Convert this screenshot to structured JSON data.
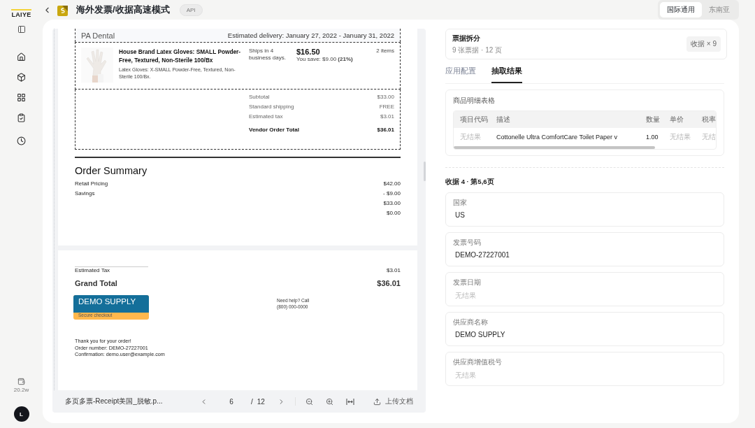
{
  "sidebar": {
    "logo": "LAIYE",
    "credits": "20.2w",
    "avatar": "L"
  },
  "header": {
    "title": "海外发票/收据高速模式",
    "badge": "API"
  },
  "region_tabs": [
    {
      "label": "国际通用",
      "selected": true
    },
    {
      "label": "东南亚",
      "selected": false
    }
  ],
  "document": {
    "vendor": "PA Dental",
    "delivery": "Estimated delivery: January 27, 2022 - January 31, 2022",
    "item": {
      "title": "House Brand Latex Gloves: SMALL Powder-Free, Textured, Non-Sterile 100/Bx",
      "description": "Latex Gloves: X-SMALL Powder-Free, Textured, Non-Sterile 100/Bx.",
      "shipping": "Ships in 4 business days.",
      "price": "$16.50",
      "savings": "You save: $9.00 **(21%)**",
      "quantity": "2 items"
    },
    "totals": [
      {
        "label": "Subtotal",
        "value": "$33.00",
        "bold": false
      },
      {
        "label": "Standard shipping",
        "value": "FREE",
        "bold": false
      },
      {
        "label": "Estimated tax",
        "value": "$3.01",
        "bold": false
      },
      {
        "label": "Vendor Order Total",
        "value": "$36.01",
        "bold": true
      }
    ],
    "summary_title": "Order Summary",
    "summary_rows": [
      {
        "label": "Retail Pricing",
        "value": "$42.00"
      },
      {
        "label": "Savings",
        "value": "- $9.00"
      },
      {
        "value": "$33.00"
      },
      {
        "value": "$0.00"
      }
    ],
    "tax": {
      "label": "Estimated Tax",
      "value": "$3.01"
    },
    "grand_total": {
      "label": "Grand Total",
      "value": "$36.01"
    },
    "logo": {
      "name": "DEMO SUPPLY",
      "tagline": "Secure checkout"
    },
    "help": [
      "Need help? Call",
      "(800) 000-0000"
    ],
    "closing": [
      "Thank you for your order!",
      "Order number: DEMO-27227001",
      "Confirmation: demo.user@example.com"
    ]
  },
  "viewer_toolbar": {
    "filename": "多页多票-Receipt美国_脱敏.p...",
    "page": "6",
    "separator": "/",
    "total": "12",
    "upload": "上传文档"
  },
  "split_card": {
    "title": "票据拆分",
    "subtitle": "9 张票据 · 12 页",
    "chip": "收据 × 9"
  },
  "result_tabs": [
    {
      "label": "应用配置",
      "selected": false
    },
    {
      "label": "抽取结果",
      "selected": true
    }
  ],
  "line_items": {
    "title": "商品明细表格",
    "columns": [
      "项目代码",
      "描述",
      "数量",
      "单价",
      "税率"
    ],
    "rows": [
      [
        {
          "text": "无结果",
          "empty": true
        },
        {
          "text": "Cottonelle Ultra ComfortCare Toilet Paper v",
          "empty": false
        },
        {
          "text": "1.00",
          "empty": false
        },
        {
          "text": "无结果",
          "empty": true
        },
        {
          "text": "无结",
          "empty": true
        }
      ]
    ]
  },
  "section_title": "收据 4 · 第5,6页",
  "fields": [
    {
      "label": "国家",
      "value": "US",
      "empty": false
    },
    {
      "label": "发票号码",
      "value": "DEMO-27227001",
      "empty": false
    },
    {
      "label": "发票日期",
      "value": "无结果",
      "empty": true
    },
    {
      "label": "供应商名称",
      "value": "DEMO SUPPLY",
      "empty": false
    },
    {
      "label": "供应商增值税号",
      "value": "无结果",
      "empty": true
    }
  ]
}
